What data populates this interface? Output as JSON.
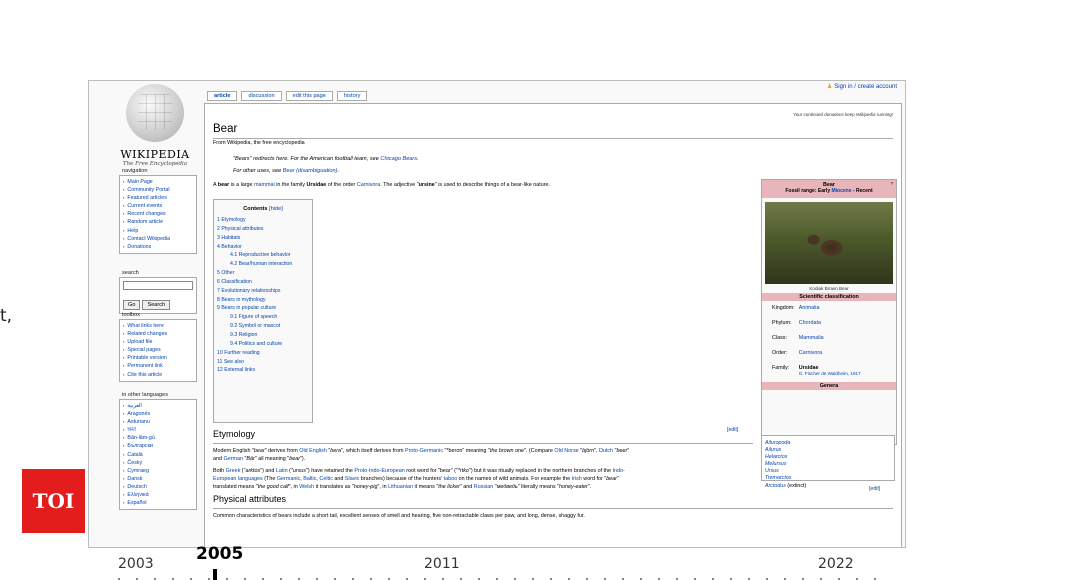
{
  "stray_text": "t,",
  "personal": {
    "text": "Sign in / create account"
  },
  "logo": {
    "wordmark": "WIKIPEDIA",
    "tagline": "The Free Encyclopedia"
  },
  "tabs": [
    {
      "label": "article",
      "active": true
    },
    {
      "label": "discussion"
    },
    {
      "label": "edit this page"
    },
    {
      "label": "history"
    }
  ],
  "sitenotice": "Your continued donations keep Wikipedia running!",
  "article": {
    "title": "Bear",
    "from": "From Wikipedia, the free encyclopedia",
    "dab1_pre": "\"Bears\" redirects here. For the American football team, see ",
    "dab1_link": "Chicago Bears",
    "dab1_post": ".",
    "dab2_pre": "For other uses, see ",
    "dab2_link": "Bear (disambiguation)",
    "dab2_post": ".",
    "intro": [
      {
        "text": "A "
      },
      {
        "text": "bear",
        "bold": true
      },
      {
        "text": " is a large "
      },
      {
        "text": "mammal",
        "link": true
      },
      {
        "text": " in the family "
      },
      {
        "text": "Ursidae",
        "bold": true
      },
      {
        "text": " of the order "
      },
      {
        "text": "Carnivora",
        "link": true
      },
      {
        "text": ". The adjective \""
      },
      {
        "text": "ursine",
        "bold": true
      },
      {
        "text": "\" is used to describe things of a bear-like nature."
      }
    ]
  },
  "toc": {
    "title": "Contents",
    "hide": "[hide]",
    "items": [
      {
        "label": "1 Etymology"
      },
      {
        "label": "2 Physical attributes"
      },
      {
        "label": "3 Habitats"
      },
      {
        "label": "4 Behavior"
      },
      {
        "label": "4.1 Reproductive behavior",
        "sub": true
      },
      {
        "label": "4.2 Bear/human interaction",
        "sub": true
      },
      {
        "label": "5 Other"
      },
      {
        "label": "6 Classification"
      },
      {
        "label": "7 Evolutionary relationships"
      },
      {
        "label": "8 Bears in mythology"
      },
      {
        "label": "9 Bears in popular culture"
      },
      {
        "label": "9.1 Figure of speech",
        "sub": true
      },
      {
        "label": "9.2 Symbol or mascot",
        "sub": true
      },
      {
        "label": "9.3 Religion",
        "sub": true
      },
      {
        "label": "9.4 Politics and culture",
        "sub": true
      },
      {
        "label": "10 Further reading"
      },
      {
        "label": "11 See also"
      },
      {
        "label": "12 External links"
      }
    ]
  },
  "sections": {
    "etymology": {
      "heading": "Etymology",
      "edit": "[edit]",
      "p1": [
        {
          "text": "Modern English \""
        },
        {
          "text": "bear",
          "italic": true
        },
        {
          "text": "\" derives from "
        },
        {
          "text": "Old English",
          "link": true
        },
        {
          "text": " \""
        },
        {
          "text": "bera",
          "italic": true
        },
        {
          "text": "\", which itself derives from "
        },
        {
          "text": "Proto-Germanic",
          "link": true
        },
        {
          "text": " \"*beron\" meaning \""
        },
        {
          "text": "the brown one",
          "italic": true
        },
        {
          "text": "\". (Compare "
        },
        {
          "text": "Old Norse",
          "link": true
        },
        {
          "text": " \""
        },
        {
          "text": "björn",
          "italic": true
        },
        {
          "text": "\", "
        },
        {
          "text": "Dutch",
          "link": true
        },
        {
          "text": " \""
        },
        {
          "text": "beer",
          "italic": true
        },
        {
          "text": "\""
        }
      ],
      "p1b": [
        {
          "text": "and "
        },
        {
          "text": "German",
          "link": true
        },
        {
          "text": " \""
        },
        {
          "text": "Bär",
          "italic": true
        },
        {
          "text": "\" all meaning \""
        },
        {
          "text": "bear",
          "italic": true
        },
        {
          "text": "\")."
        }
      ],
      "p2": [
        {
          "text": "Both "
        },
        {
          "text": "Greek",
          "link": true
        },
        {
          "text": " (\""
        },
        {
          "text": "arktos",
          "italic": true
        },
        {
          "text": "\") and "
        },
        {
          "text": "Latin",
          "link": true
        },
        {
          "text": " (\""
        },
        {
          "text": "ursus",
          "italic": true
        },
        {
          "text": "\") have retained the "
        },
        {
          "text": "Proto-Indo-European",
          "link": true
        },
        {
          "text": " root word for \"bear\" (\""
        },
        {
          "text": "*rtko",
          "italic": true
        },
        {
          "text": "\") but it was ritually replaced in the northern branches of the "
        },
        {
          "text": "Indo-",
          "link": true
        }
      ],
      "p2b": [
        {
          "text": "European languages",
          "link": true
        },
        {
          "text": " (The "
        },
        {
          "text": "Germanic",
          "link": true
        },
        {
          "text": ", "
        },
        {
          "text": "Baltic",
          "link": true
        },
        {
          "text": ", "
        },
        {
          "text": "Celtic",
          "link": true
        },
        {
          "text": " and "
        },
        {
          "text": "Slavic",
          "link": true
        },
        {
          "text": " branches) because of the hunters' "
        },
        {
          "text": "taboo",
          "link": true
        },
        {
          "text": " on the names of wild animals. For example the "
        },
        {
          "text": "Irish",
          "link": true
        },
        {
          "text": " word for \""
        },
        {
          "text": "bear",
          "italic": true
        },
        {
          "text": "\""
        }
      ],
      "p2c": [
        {
          "text": "translated means \""
        },
        {
          "text": "the good calf",
          "italic": true
        },
        {
          "text": "\", in "
        },
        {
          "text": "Welsh",
          "link": true
        },
        {
          "text": " it translates as \""
        },
        {
          "text": "honey-pig",
          "italic": true
        },
        {
          "text": "\", in "
        },
        {
          "text": "Lithuanian",
          "link": true
        },
        {
          "text": " it means \""
        },
        {
          "text": "the licker",
          "italic": true
        },
        {
          "text": "\" and "
        },
        {
          "text": "Russian",
          "link": true
        },
        {
          "text": " \""
        },
        {
          "text": "медведь",
          "italic": true
        },
        {
          "text": "\" literally means \""
        },
        {
          "text": "honey-eater",
          "italic": true
        },
        {
          "text": "\"."
        }
      ]
    },
    "physical": {
      "heading": "Physical attributes",
      "edit": "[edit]",
      "p1": [
        {
          "text": "Common characteristics of bears include a short tail, excellent senses of smell and hearing, five non-retractable claws per paw, and long, dense, shaggy fur."
        }
      ]
    }
  },
  "infobox": {
    "name": "Bear",
    "fossil_pre": "Fossil range: Early ",
    "fossil_link": "Miocene",
    "fossil_post": " - Recent",
    "qm": "?",
    "caption": "Kodiak Brown Bear",
    "classification_title": "Scientific classification",
    "rows": [
      {
        "rank": "Kingdom:",
        "value": "Animalia"
      },
      {
        "rank": "Phylum:",
        "value": "Chordata"
      },
      {
        "rank": "Class:",
        "value": "Mammalia"
      },
      {
        "rank": "Order:",
        "value": "Carnivora"
      },
      {
        "rank": "Family:",
        "value": "Ursidae",
        "bold": true
      }
    ],
    "authority": "G. Fischer de Waldheim, 1817",
    "genera_title": "Genera",
    "genera": [
      {
        "name": "Ailuropoda"
      },
      {
        "name": "Ailurus"
      },
      {
        "name": "Helarctos"
      },
      {
        "name": "Melursus"
      },
      {
        "name": "Ursus"
      },
      {
        "name": "Tremarctos"
      },
      {
        "name": "Arctodus",
        "note": " (extinct)"
      }
    ]
  },
  "sidebar": {
    "navigation": {
      "title": "navigation",
      "items": [
        "Main Page",
        "Community Portal",
        "Featured articles",
        "Current events",
        "Recent changes",
        "Random article",
        "Help",
        "Contact Wikipedia",
        "Donations"
      ]
    },
    "search": {
      "title": "search",
      "go": "Go",
      "search": "Search"
    },
    "toolbox": {
      "title": "toolbox",
      "items": [
        "What links here",
        "Related changes",
        "Upload file",
        "Special pages",
        "Printable version",
        "Permanent link",
        "Cite this article"
      ]
    },
    "languages": {
      "title": "in other languages",
      "items": [
        "العربية",
        "Aragonés",
        "Asturianu",
        "ক্ষমা",
        "Bân-lâm-gú",
        "Български",
        "Català",
        "Česky",
        "Cymraeg",
        "Dansk",
        "Deutsch",
        "Ελληνικά",
        "Español"
      ]
    }
  },
  "overlay": {
    "logo": "TOI",
    "years": [
      {
        "label": "2003"
      },
      {
        "label": "2005",
        "active": true
      },
      {
        "label": "2011"
      },
      {
        "label": "2022"
      }
    ]
  }
}
